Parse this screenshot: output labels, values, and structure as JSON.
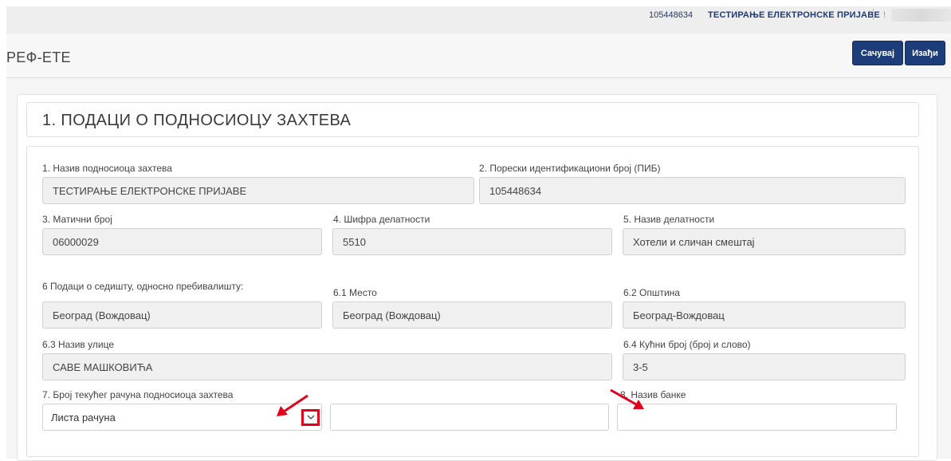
{
  "topbar": {
    "pib": "105448634",
    "company": "ТЕСТИРАЊЕ ЕЛЕКТРОНСКЕ ПРИЈАВЕ",
    "separator_char": "!"
  },
  "header": {
    "title": "РЕФ-ЕТЕ",
    "save_label": "Сачувај",
    "exit_label": "Изађи"
  },
  "section": {
    "heading": "1. ПОДАЦИ О ПОДНОСИОЦУ ЗАХТЕВА"
  },
  "form": {
    "name_label": "1. Назив подносиоца захтева",
    "name_value": "ТЕСТИРАЊЕ ЕЛЕКТРОНСКЕ ПРИЈАВЕ",
    "pib_label": "2. Порески идентификациони број (ПИБ)",
    "pib_value": "105448634",
    "mb_label": "3. Матични број",
    "mb_value": "06000029",
    "activity_code_label": "4. Шифра делатности",
    "activity_code_value": "5510",
    "activity_name_label": "5. Назив делатности",
    "activity_name_value": "Хотели и сличан смештај",
    "seat_label": "6 Подаци о седишту, односно пребивалишту:",
    "seat_value": "Београд (Вождовац)",
    "place_label": "6.1 Место",
    "place_value": "Београд (Вождовац)",
    "municipality_label": "6.2 Општина",
    "municipality_value": "Београд-Вождовац",
    "street_label": "6.3 Назив улице",
    "street_value": "САВЕ МАШКОВИЋА",
    "house_label": "6.4 Кућни број (број и слово)",
    "house_value": "3-5",
    "account_label": "7. Број текућег рачуна подносиоца захтева",
    "account_select_value": "Листа рачуна",
    "account_number_value": "",
    "bank_label": "8. Назив банке",
    "bank_value": ""
  },
  "colors": {
    "primary_button": "#1c3d7a",
    "annotation_red": "#e2001a"
  }
}
